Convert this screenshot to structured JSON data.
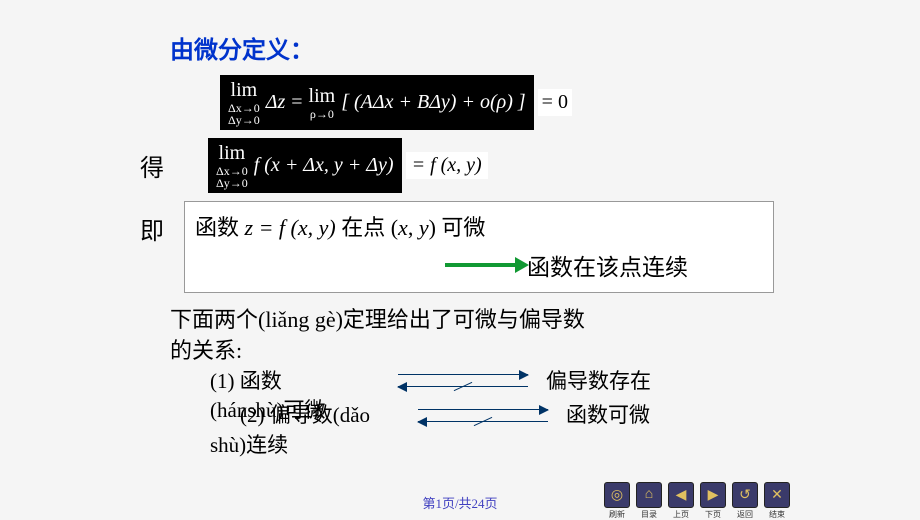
{
  "title": "由微分定义：",
  "eq1": {
    "lim1_sub1": "Δx→0",
    "lim1_sub2": "Δy→0",
    "lhs": "Δz",
    "eq": "=",
    "lim2_sub": "ρ→0",
    "rhs": "[ (AΔx + BΔy) + o(ρ) ]",
    "result": "= 0"
  },
  "got_label": "得",
  "eq2": {
    "lim_sub1": "Δx→0",
    "lim_sub2": "Δy→0",
    "body": "f (x + Δx, y + Δy)",
    "rhs": "= f (x, y)"
  },
  "ji_label": "即",
  "box": {
    "line1_prefix": "函数 ",
    "line1_math": "z = f (x, y)",
    "line1_mid": " 在点 (",
    "line1_x": "x",
    "line1_comma": ", ",
    "line1_y": "y",
    "line1_suffix": ") 可微",
    "conclusion": "函数在该点连续"
  },
  "para": {
    "l1": "下面两个(liǎng gè)定理给出了可微与偏导数",
    "l2": "的关系:"
  },
  "rel1": {
    "left": "(1) 函数",
    "left2": "(hánshù)可微",
    "right": "偏导数存在"
  },
  "rel2": {
    "left": "(2) 偏导数(dǎo",
    "left2": "shù)连续",
    "right": "函数可微"
  },
  "pager": "第1页/共24页",
  "nav": {
    "l1": "刷新",
    "l2": "目录",
    "l3": "上页",
    "l4": "下页",
    "l5": "返回",
    "l6": "结束"
  }
}
